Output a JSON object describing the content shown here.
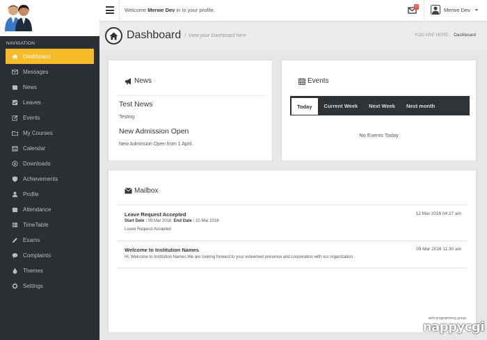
{
  "header": {
    "welcome_prefix": "Welcome",
    "welcome_user": "Merwe Dev",
    "welcome_suffix": "in to your profile.",
    "mail_count": "0",
    "user_name": "Merwe Dev"
  },
  "sidebar": {
    "heading": "NAVIGATION",
    "items": [
      {
        "label": "Dashboard",
        "icon": "home-icon"
      },
      {
        "label": "Messages",
        "icon": "envelope-icon"
      },
      {
        "label": "News",
        "icon": "book-icon"
      },
      {
        "label": "Leaves",
        "icon": "check-square-icon"
      },
      {
        "label": "Events",
        "icon": "edit-icon"
      },
      {
        "label": "My Courses",
        "icon": "folder-icon"
      },
      {
        "label": "Calendar",
        "icon": "calendar-icon"
      },
      {
        "label": "Downloads",
        "icon": "download-icon"
      },
      {
        "label": "Achievements",
        "icon": "shield-icon"
      },
      {
        "label": "Profile",
        "icon": "user-icon"
      },
      {
        "label": "Attendance",
        "icon": "book-icon"
      },
      {
        "label": "TimeTable",
        "icon": "table-icon"
      },
      {
        "label": "Exams",
        "icon": "pencil-icon"
      },
      {
        "label": "Complaints",
        "icon": "comment-icon"
      },
      {
        "label": "Themes",
        "icon": "tint-icon"
      },
      {
        "label": "Settings",
        "icon": "gear-icon"
      }
    ]
  },
  "page": {
    "title": "Dashboard",
    "subtitle": "View your Dashboard here",
    "crumb_label": "YOU ARE HERE:",
    "crumb_current": "Dashboard"
  },
  "news": {
    "title": "News",
    "items": [
      {
        "title": "Test News",
        "body": "Testing"
      },
      {
        "title": "New Admission Open",
        "body": "New Admission Open from 1 April."
      }
    ]
  },
  "events": {
    "title": "Events",
    "tabs": [
      "Today",
      "Current Week",
      "Next Week",
      "Next month"
    ],
    "empty_text": "No Events Today"
  },
  "mailbox": {
    "title": "Mailbox",
    "messages": [
      {
        "subject": "Leave Request Accepted",
        "date": "12 Mar 2016 04:27 am",
        "start_label": "Start Date :",
        "start_value": "09 Mar 2016",
        "end_label": "End Date :",
        "end_value": "10 Mar 2016",
        "body": "Leave Request Accepted"
      },
      {
        "subject": "Welcome to Institution Names",
        "date": "09 Mar 2016 11:30 am",
        "body": "Hi, Welcome to Institution Names.We are looking forward to your esteemed presence and cooperation with our organization."
      }
    ]
  },
  "watermark": {
    "small": "web programming group",
    "big": "nappycgi"
  },
  "colors": {
    "accent": "#f5bb29",
    "sidebar_bg": "#2b2e33",
    "badge": "#e94e3c"
  }
}
